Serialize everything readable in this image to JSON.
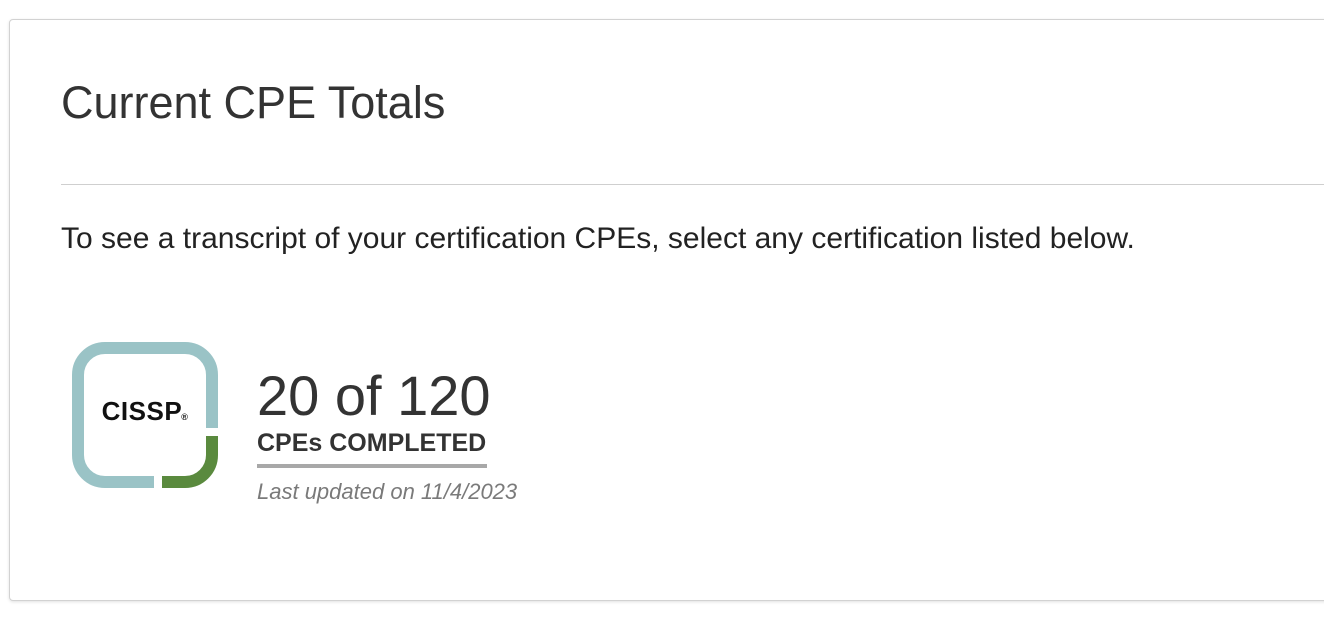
{
  "panel": {
    "title": "Current CPE Totals",
    "instructions": "To see a transcript of your certification CPEs, select any certification listed below."
  },
  "certifications": [
    {
      "badge": {
        "label": "CISSP",
        "mark": "®",
        "frame_color": "#9ac3c6",
        "accent_color": "#5a8a3e"
      },
      "count_text": "20 of 120",
      "completed": 20,
      "required": 120,
      "completed_label": "CPEs COMPLETED",
      "last_updated": "Last updated on 11/4/2023"
    }
  ]
}
